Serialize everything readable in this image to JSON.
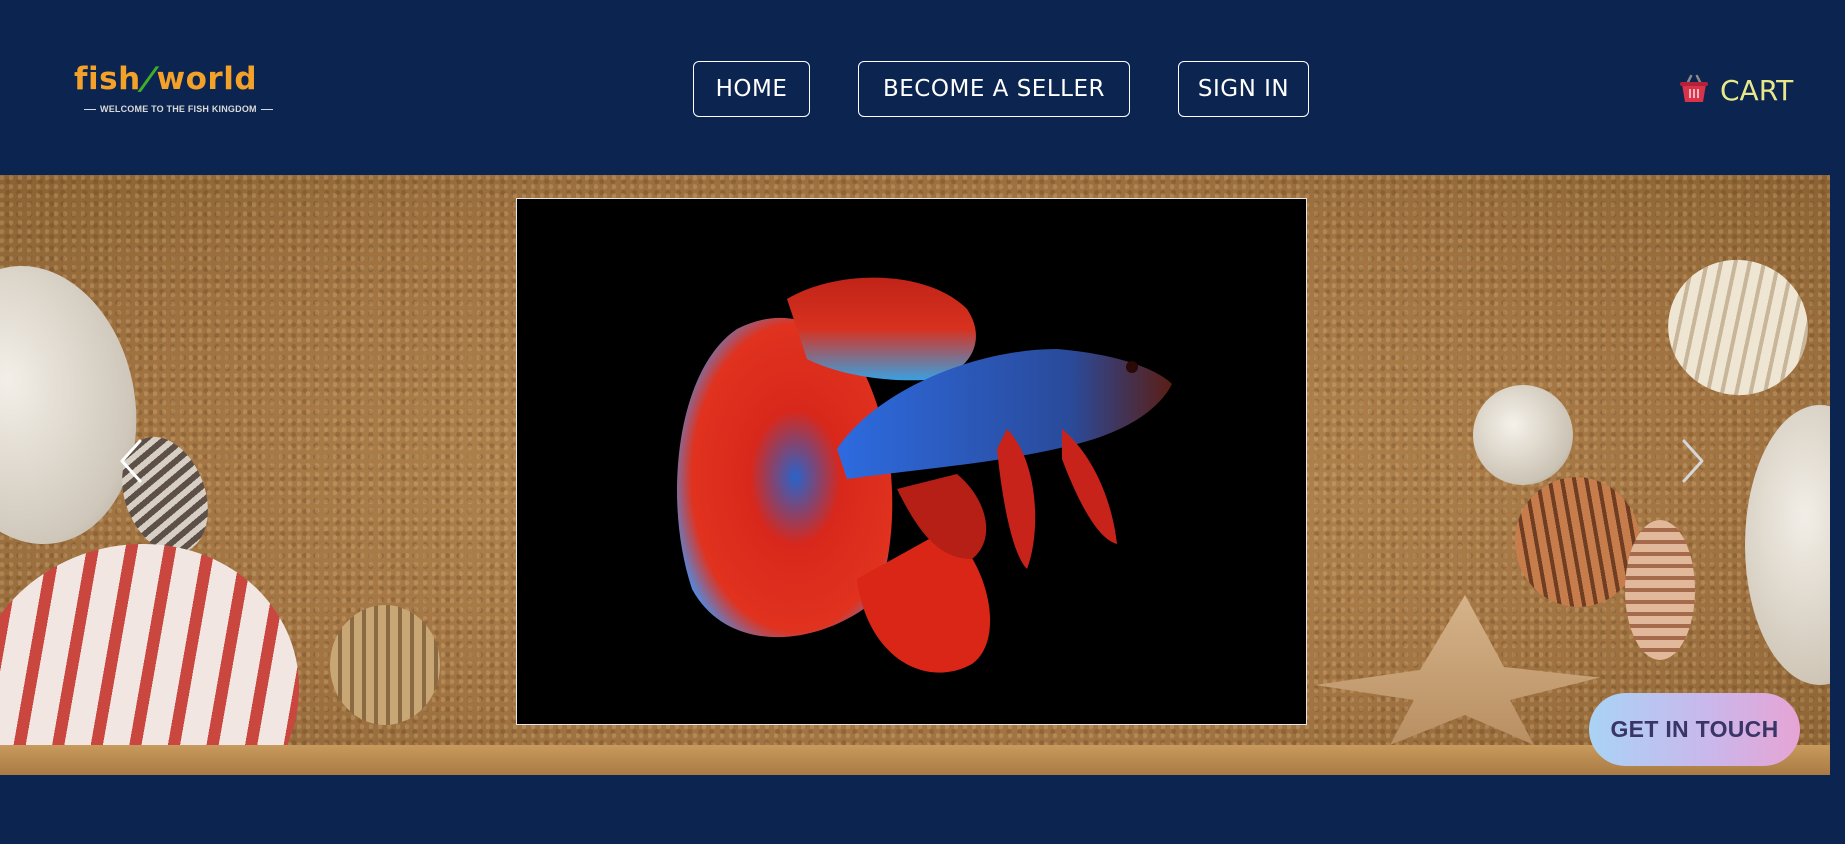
{
  "header": {
    "logo": {
      "brand": {
        "part1": "fish",
        "part2": "world"
      },
      "tagline": "WELCOME TO THE FISH KINGDOM"
    },
    "nav": [
      {
        "label": "HOME"
      },
      {
        "label": "BECOME A SELLER"
      },
      {
        "label": "SIGN IN"
      }
    ],
    "cart": {
      "label": "CART",
      "icon": "shopping-basket-icon"
    }
  },
  "carousel": {
    "slide_image": "betta-fish-photo",
    "prev_icon": "chevron-left-icon",
    "next_icon": "chevron-right-icon",
    "background": "sand-and-seashells"
  },
  "contact": {
    "label": "GET IN TOUCH"
  },
  "colors": {
    "background": "#0c2550",
    "logo_orange": "#f4a12a",
    "logo_green": "#3fae2a",
    "cart_text": "#e8e88a",
    "touch_gradient_start": "#a9d3f5",
    "touch_gradient_end": "#e6a4d4",
    "touch_text": "#3a3567"
  }
}
